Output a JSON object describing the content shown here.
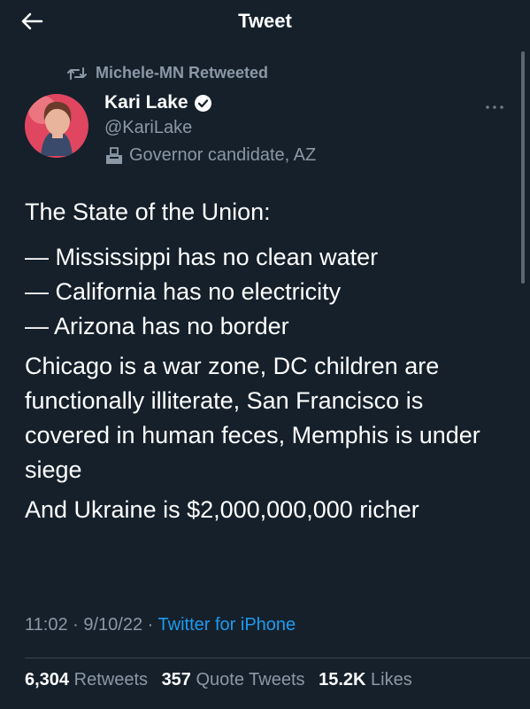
{
  "header": {
    "title": "Tweet",
    "back_icon": "arrow-left-icon"
  },
  "retweet": {
    "icon": "retweet-icon",
    "text": "Michele-MN Retweeted"
  },
  "author": {
    "name": "Kari Lake",
    "verified_icon": "verified-badge-icon",
    "handle": "@KariLake",
    "label_icon": "ballot-box-icon",
    "label": "Governor candidate, AZ"
  },
  "more_icon": "more-horizontal-icon",
  "tweet": {
    "line1": "The State of the Union:",
    "line2": "— Mississippi has no clean water",
    "line3": "— California has no electricity",
    "line4": "— Arizona has no border",
    "para2": "Chicago is a war zone, DC children are functionally illiterate, San Francisco is covered in human feces, Memphis is under siege",
    "para3": "And Ukraine is $2,000,000,000 richer"
  },
  "meta": {
    "time": "11:02",
    "sep1": "·",
    "date": "9/10/22",
    "sep2": "·",
    "source": "Twitter for iPhone"
  },
  "stats": {
    "retweets_count": "6,304",
    "retweets_label": "Retweets",
    "quotes_count": "357",
    "quotes_label": "Quote Tweets",
    "likes_count": "15.2K",
    "likes_label": "Likes"
  },
  "colors": {
    "background": "#15202b",
    "accent": "#1d9bf0",
    "muted": "#8b98a5"
  }
}
